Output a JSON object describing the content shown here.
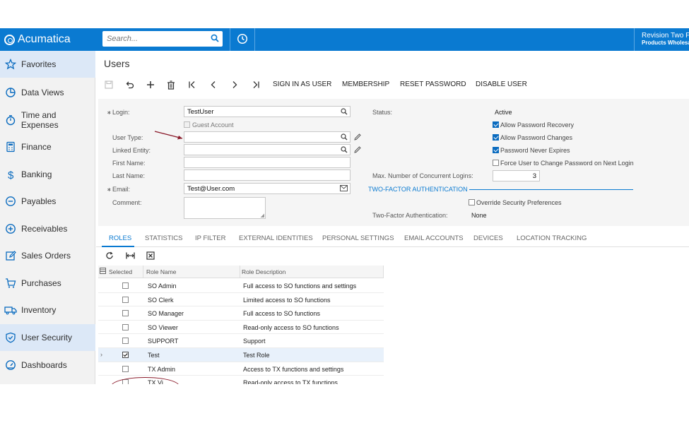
{
  "header": {
    "brand": "Acumatica",
    "search_placeholder": "Search...",
    "company_line1": "Revision Two F",
    "company_line2": "Products Wholesa"
  },
  "sidebar": {
    "items": [
      {
        "label": "Favorites",
        "icon": "star-icon"
      },
      {
        "label": "Data Views",
        "icon": "pie-chart-icon"
      },
      {
        "label": "Time and Expenses",
        "icon": "stopwatch-icon"
      },
      {
        "label": "Finance",
        "icon": "calculator-icon"
      },
      {
        "label": "Banking",
        "icon": "dollar-icon"
      },
      {
        "label": "Payables",
        "icon": "minus-circle-icon"
      },
      {
        "label": "Receivables",
        "icon": "plus-circle-icon"
      },
      {
        "label": "Sales Orders",
        "icon": "pencil-square-icon"
      },
      {
        "label": "Purchases",
        "icon": "cart-icon"
      },
      {
        "label": "Inventory",
        "icon": "truck-icon"
      },
      {
        "label": "User Security",
        "icon": "shield-icon"
      },
      {
        "label": "Dashboards",
        "icon": "gauge-icon"
      }
    ]
  },
  "page": {
    "title": "Users"
  },
  "toolbar": {
    "sign_in_as_user": "SIGN IN AS USER",
    "membership": "MEMBERSHIP",
    "reset_password": "RESET PASSWORD",
    "disable_user": "DISABLE USER"
  },
  "form": {
    "login_label": "Login:",
    "login_value": "TestUser",
    "guest_account": "Guest Account",
    "user_type_label": "User Type:",
    "linked_entity_label": "Linked Entity:",
    "first_name_label": "First Name:",
    "last_name_label": "Last Name:",
    "email_label": "Email:",
    "email_value": "Test@User.com",
    "comment_label": "Comment:",
    "status_label": "Status:",
    "status_value": "Active",
    "allow_password_recovery": "Allow Password Recovery",
    "allow_password_changes": "Allow Password Changes",
    "password_never_expires": "Password Never Expires",
    "force_change_password": "Force User to Change Password on Next Login",
    "max_logins_label": "Max. Number of Concurrent Logins:",
    "max_logins_value": "3",
    "tfa_heading": "TWO-FACTOR AUTHENTICATION",
    "override_security": "Override Security Preferences",
    "tfa_label": "Two-Factor Authentication:",
    "tfa_value": "None"
  },
  "tabs": [
    "ROLES",
    "STATISTICS",
    "IP FILTER",
    "EXTERNAL IDENTITIES",
    "PERSONAL SETTINGS",
    "EMAIL ACCOUNTS",
    "DEVICES",
    "LOCATION TRACKING"
  ],
  "grid": {
    "headers": [
      "Selected",
      "Role Name",
      "Role Description"
    ],
    "rows": [
      {
        "selected": false,
        "name": "SO Admin",
        "description": "Full access to SO functions and settings"
      },
      {
        "selected": false,
        "name": "SO Clerk",
        "description": "Limited access to SO functions"
      },
      {
        "selected": false,
        "name": "SO Manager",
        "description": "Full access to SO functions"
      },
      {
        "selected": false,
        "name": "SO Viewer",
        "description": "Read-only access to SO functions"
      },
      {
        "selected": false,
        "name": "SUPPORT",
        "description": "Support"
      },
      {
        "selected": true,
        "name": "Test",
        "description": "Test Role"
      },
      {
        "selected": false,
        "name": "TX Admin",
        "description": "Access to TX functions and settings"
      },
      {
        "selected": false,
        "name": "TX Vi",
        "description": "Read-only access to TX functions"
      }
    ]
  },
  "colors": {
    "brand_blue": "#0a7ad1",
    "annotation_red": "#8a1a2a"
  }
}
